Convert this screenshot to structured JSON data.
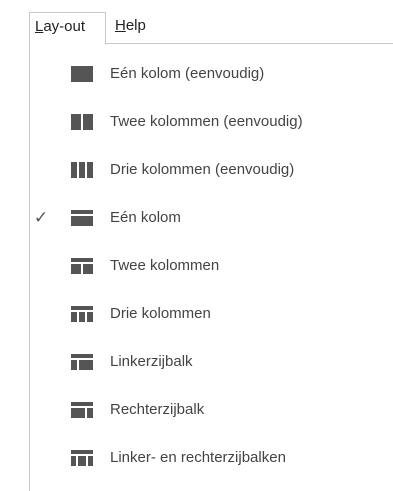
{
  "menubar": {
    "tabs": [
      {
        "first": "L",
        "rest": "ay-out"
      },
      {
        "first": "H",
        "rest": "elp"
      }
    ]
  },
  "layout_menu": {
    "items": [
      {
        "label": "Eén kolom (eenvoudig)",
        "icon": "layout-one-column-simple-icon",
        "checked": false
      },
      {
        "label": "Twee kolommen (eenvoudig)",
        "icon": "layout-two-columns-simple-icon",
        "checked": false
      },
      {
        "label": "Drie kolommen (eenvoudig)",
        "icon": "layout-three-columns-simple-icon",
        "checked": false
      },
      {
        "label": "Eén kolom",
        "icon": "layout-one-column-icon",
        "checked": true,
        "check_mark": "✓"
      },
      {
        "label": "Twee kolommen",
        "icon": "layout-two-columns-icon",
        "checked": false
      },
      {
        "label": "Drie kolommen",
        "icon": "layout-three-columns-icon",
        "checked": false
      },
      {
        "label": "Linkerzijbalk",
        "icon": "layout-left-sidebar-icon",
        "checked": false
      },
      {
        "label": "Rechterzijbalk",
        "icon": "layout-right-sidebar-icon",
        "checked": false
      },
      {
        "label": "Linker- en rechterzijbalken",
        "icon": "layout-both-sidebars-icon",
        "checked": false
      }
    ]
  },
  "colors": {
    "icon": "#555555",
    "border": "#c8c8c8",
    "text": "#444444"
  }
}
